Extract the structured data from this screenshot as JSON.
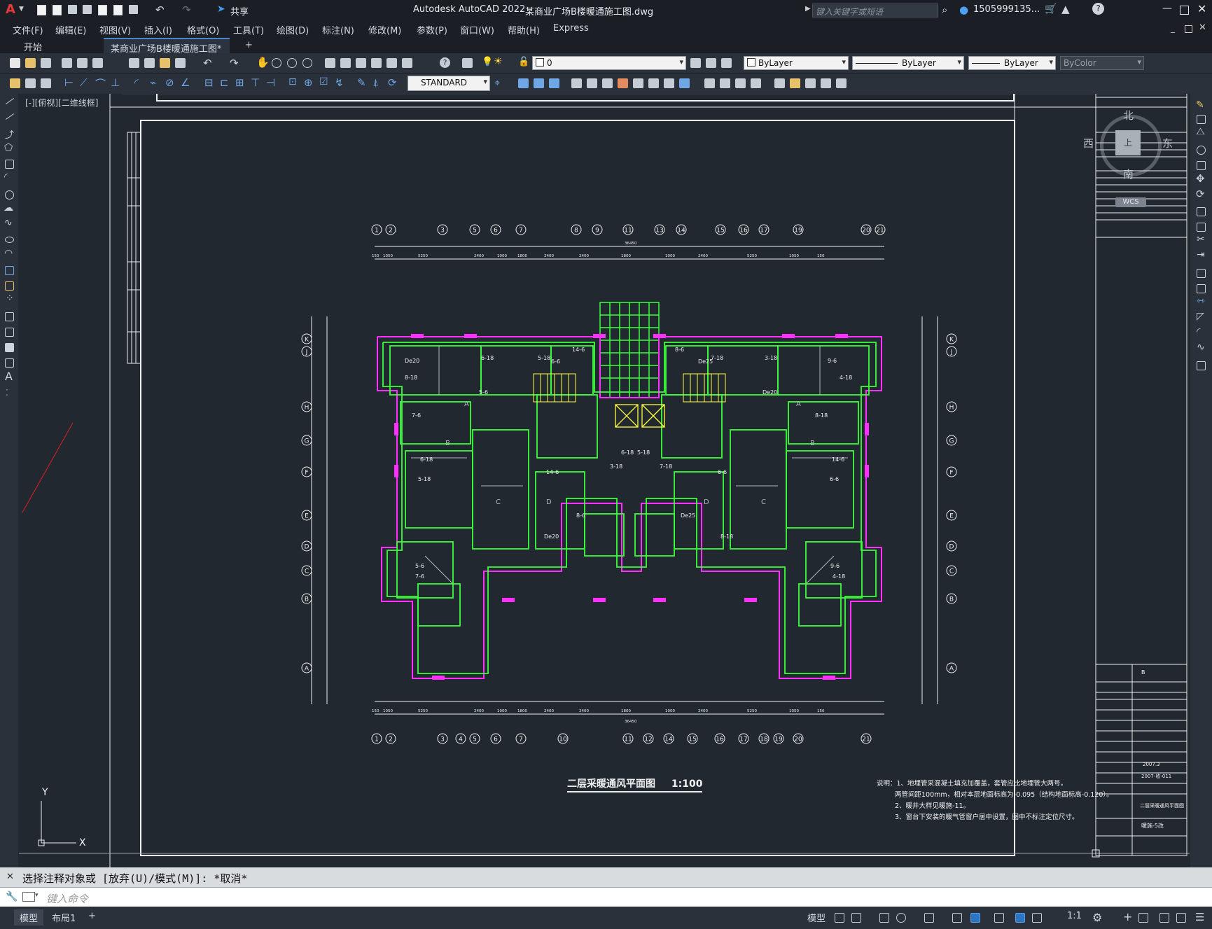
{
  "app": {
    "title": "Autodesk AutoCAD 2022",
    "file": "某商业广场B楼暖通施工图.dwg",
    "share_label": "共享",
    "search_placeholder": "键入关键字或短语",
    "user": "1505999135...",
    "logo": "A"
  },
  "menu": [
    "文件(F)",
    "编辑(E)",
    "视图(V)",
    "插入(I)",
    "格式(O)",
    "工具(T)",
    "绘图(D)",
    "标注(N)",
    "修改(M)",
    "参数(P)",
    "窗口(W)",
    "帮助(H)",
    "Express"
  ],
  "tabs": {
    "start": "开始",
    "doc": "某商业广场B楼暖通施工图*",
    "add": "+"
  },
  "properties": {
    "layer": "0",
    "color": "ByLayer",
    "linetype": "ByLayer",
    "lineweight": "ByLayer",
    "plotstyle": "ByColor",
    "textstyle": "STANDARD"
  },
  "viewport_label": "[-][俯视][二维线框]",
  "viewcube": {
    "north": "北",
    "south": "南",
    "west": "西",
    "east": "东",
    "top": "上",
    "wcs": "WCS"
  },
  "ucs": {
    "x": "X",
    "y": "Y"
  },
  "drawing": {
    "title": "二层采暖通风平面图",
    "scale": "1:100",
    "top_axes": [
      "1",
      "2",
      "3",
      "5",
      "6",
      "7",
      "8",
      "9",
      "11",
      "13",
      "14",
      "15",
      "16",
      "17",
      "19",
      "20",
      "21"
    ],
    "bottom_axes": [
      "1",
      "2",
      "3",
      "4",
      "5",
      "6",
      "7",
      "10",
      "11",
      "12",
      "14",
      "15",
      "16",
      "17",
      "18",
      "19",
      "20",
      "21"
    ],
    "left_axes": [
      "K",
      "J",
      "H",
      "G",
      "F",
      "E",
      "D",
      "C",
      "B",
      "A"
    ],
    "top_dims": [
      "150",
      "1050",
      "5250",
      "2400",
      "1000",
      "1800",
      "2400",
      "2400",
      "1800",
      "1000",
      "2400",
      "5250",
      "1050",
      "150"
    ],
    "total_dim": "36450",
    "room_labels": [
      "A",
      "B",
      "C",
      "D",
      "D",
      "C",
      "B",
      "A"
    ],
    "pipe_labels": [
      "De20",
      "8-18",
      "6-18",
      "5-18",
      "14-6",
      "6-6",
      "5-6",
      "7-6",
      "9-6",
      "4-18",
      "3-18",
      "7-18",
      "8-6",
      "De25"
    ],
    "notes": [
      "说明：1、地埋管采混凝土填充加覆盖，套管应比地埋管大两号，",
      "两管间距100mm，相对本层地面标高为-0.095（结构地面标高-0.120）。",
      "2、暖井大样见暖施-11。",
      "3、窗台下安装的暖气管窗户居中设置，图中不标注定位尺寸。"
    ],
    "titleblock_project": "B",
    "titleblock_date": "2007.3",
    "titleblock_no": "2007-收-011",
    "titleblock_sheet": "二层采暖通风平面图",
    "titleblock_sheetno": "暖施-5改"
  },
  "command": {
    "history": "选择注释对象或 [放弃(U)/模式(M)]: *取消*",
    "placeholder": "键入命令"
  },
  "status": {
    "model_tab": "模型",
    "layout_tab": "布局1",
    "model_btn": "模型",
    "scale": "1:1"
  },
  "colors": {
    "green": "#3cff3c",
    "magenta": "#ff30ff",
    "yellow": "#ffff3c",
    "white": "#f0f0f0",
    "accent": "#2f74c0"
  }
}
